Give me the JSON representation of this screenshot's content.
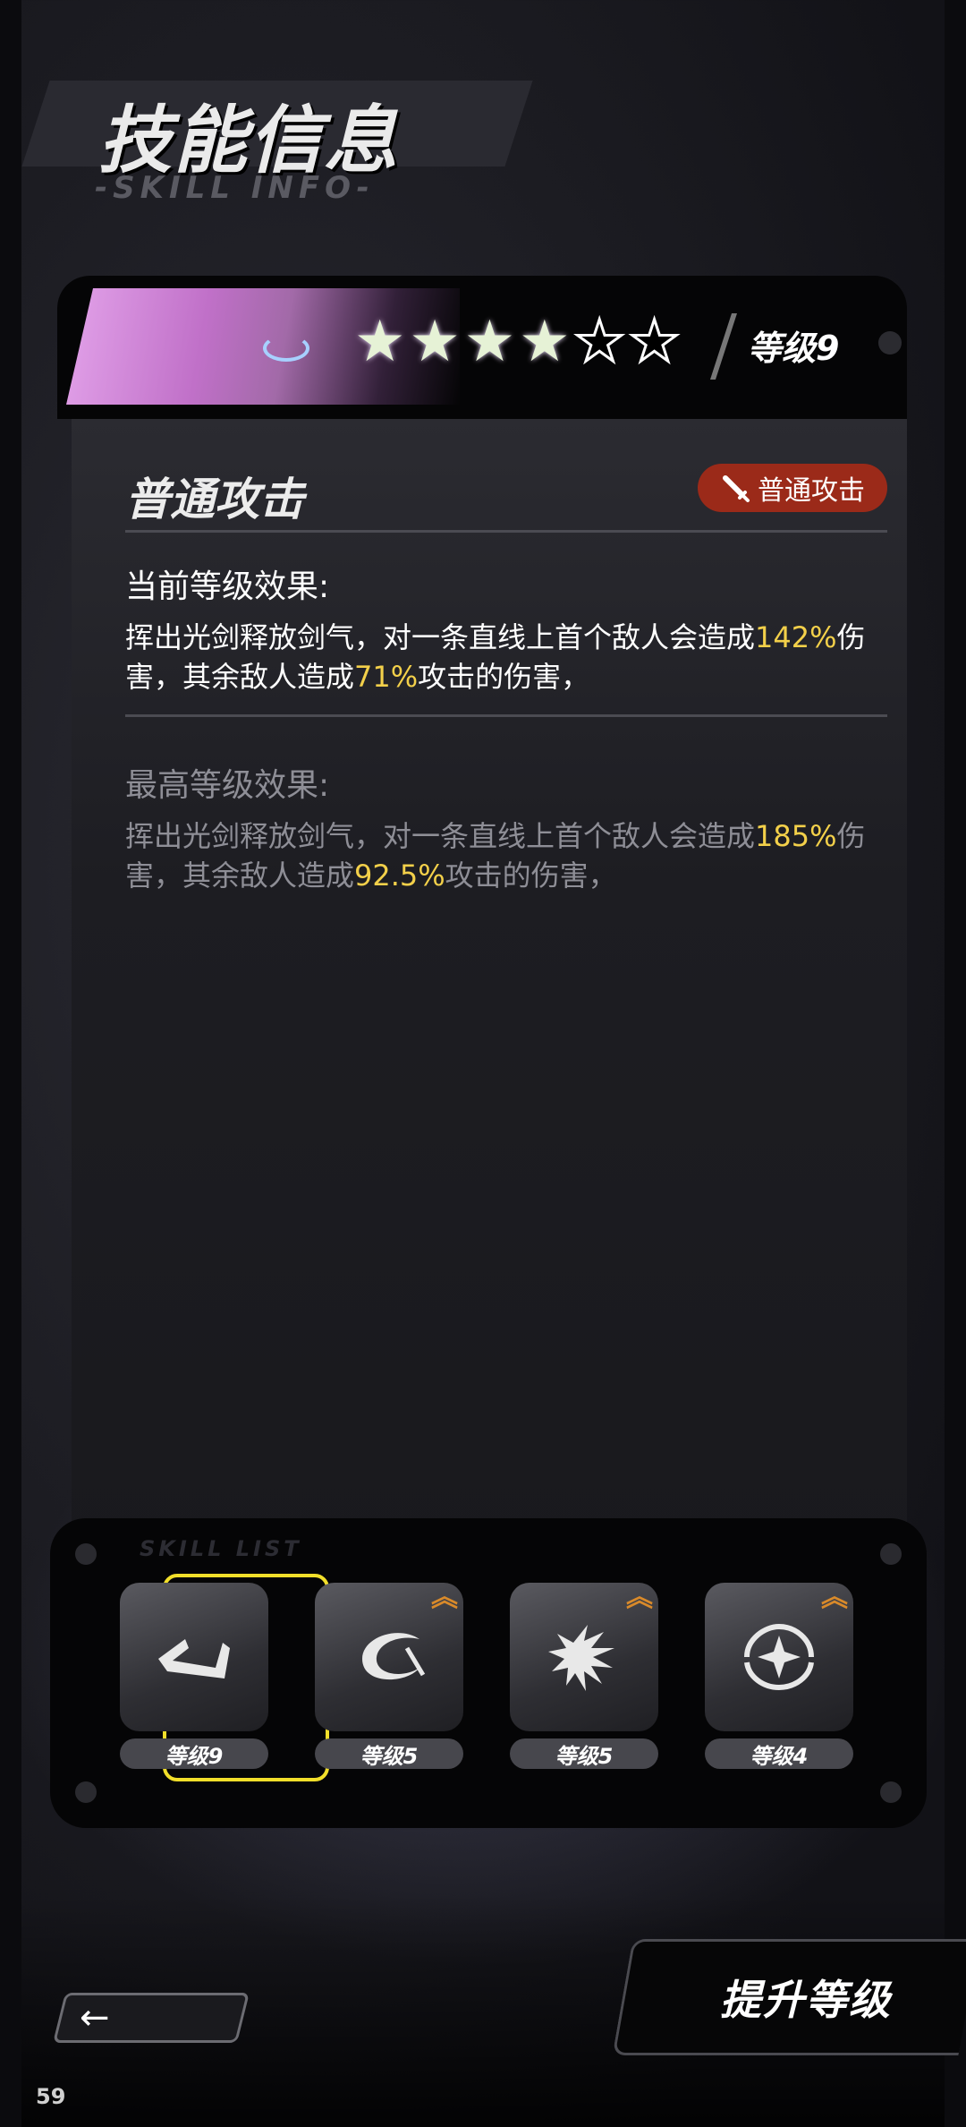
{
  "header": {
    "title": "技能信息",
    "subtitle": "-SKILL INFO-"
  },
  "skill": {
    "stars_filled": 4,
    "stars_total": 6,
    "level_label": "等级9",
    "name": "普通攻击",
    "type_badge": "普通攻击",
    "current": {
      "title": "当前等级效果:",
      "line_a": "挥出光剑释放剑气，对一条直线上首个敌人会造成",
      "value_a": "142%",
      "line_b": "伤害，其余敌人造成",
      "value_b": "71%",
      "line_c": "攻击的伤害，"
    },
    "max": {
      "title": "最高等级效果:",
      "line_a": "挥出光剑释放剑气，对一条直线上首个敌人会造成",
      "value_a": "185%",
      "line_b": "伤害，其余敌人造成",
      "value_b": "92.5%",
      "line_c": "攻击的伤害，"
    }
  },
  "skill_list": {
    "label": "SKILL LIST",
    "items": [
      {
        "icon": "blade-slash-icon",
        "level": "等级9",
        "selected": true,
        "upgradable": false
      },
      {
        "icon": "crescent-slash-icon",
        "level": "等级5",
        "selected": false,
        "upgradable": true
      },
      {
        "icon": "burst-wave-icon",
        "level": "等级5",
        "selected": false,
        "upgradable": true
      },
      {
        "icon": "star-ring-icon",
        "level": "等级4",
        "selected": false,
        "upgradable": true
      }
    ]
  },
  "buttons": {
    "back": "←",
    "upgrade": "提升等级"
  },
  "page_number": "59",
  "colors": {
    "highlight": "#f3d04a",
    "badge": "#9b2a19",
    "select_frame": "#f2df2a",
    "upgrade_arrow": "#d98a2a"
  }
}
